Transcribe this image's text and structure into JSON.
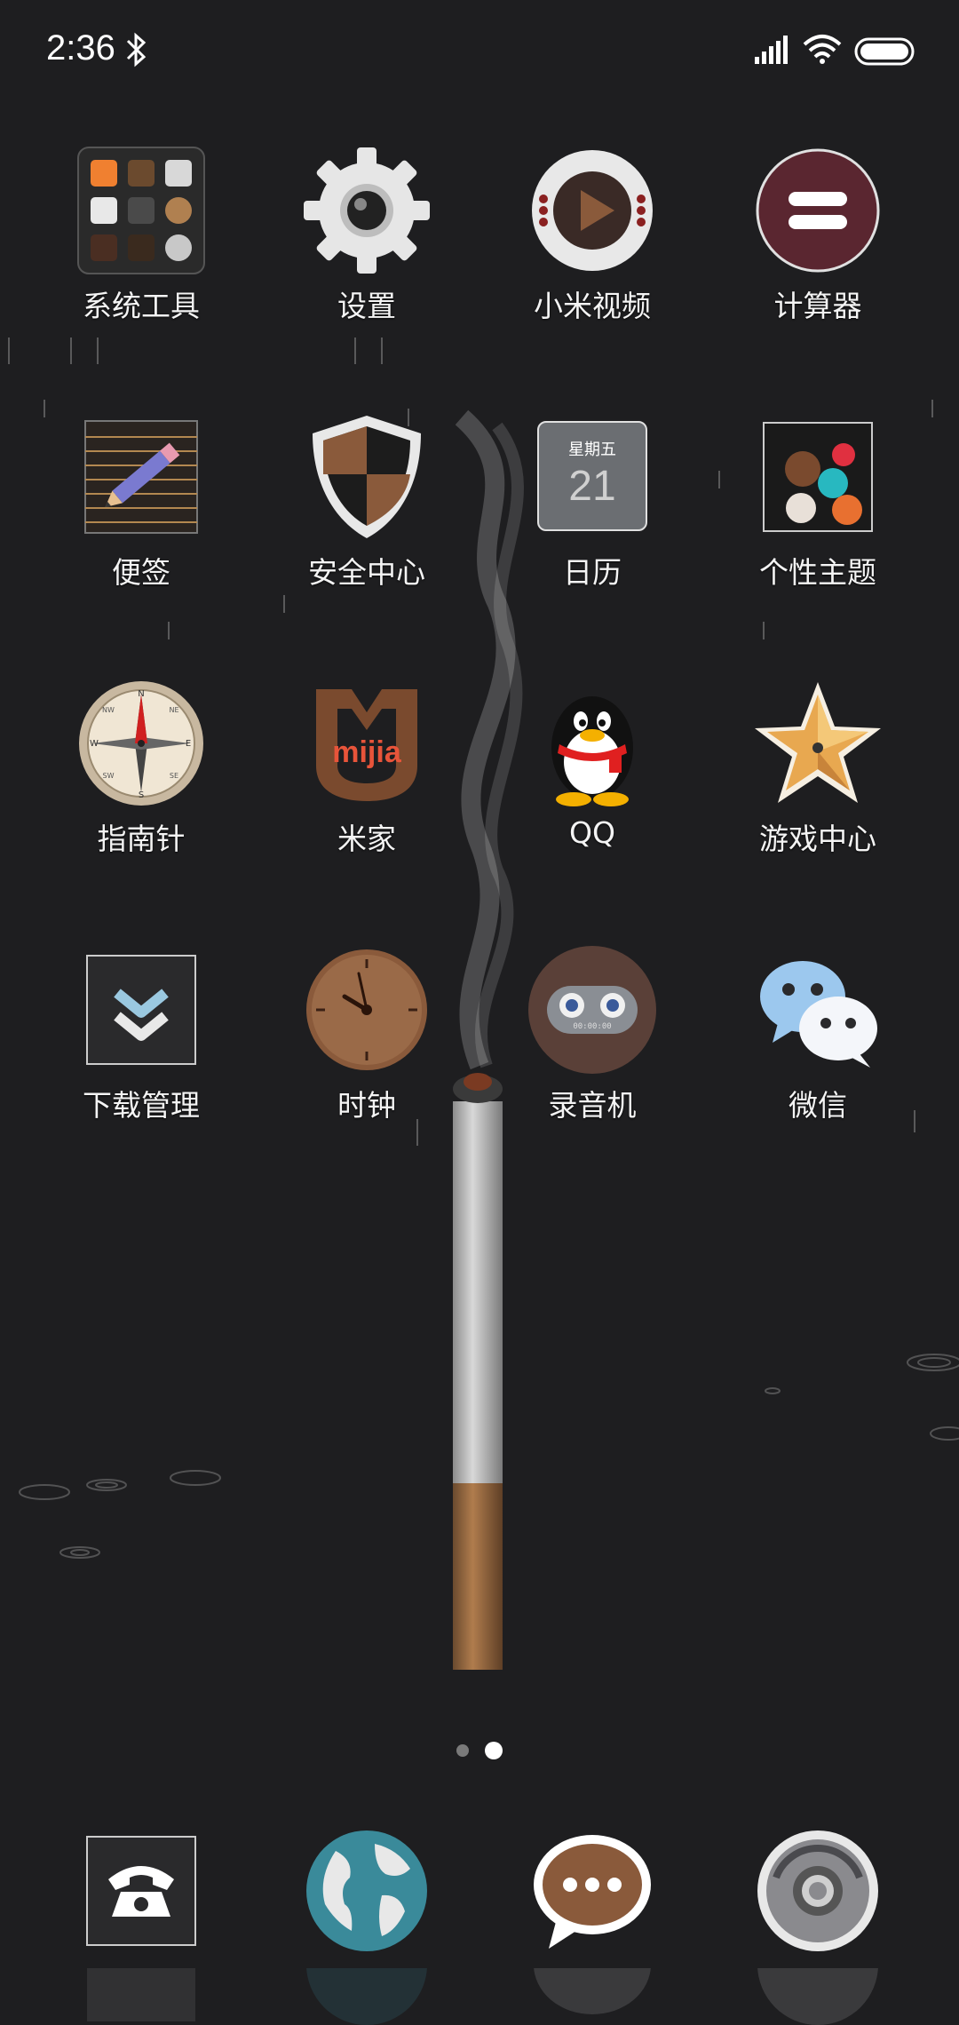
{
  "status_bar": {
    "time": "2:36",
    "icons": [
      "bluetooth-icon",
      "signal-icon",
      "wifi-icon",
      "battery-icon"
    ]
  },
  "apps": [
    {
      "label": "系统工具",
      "icon": "folder-icon"
    },
    {
      "label": "设置",
      "icon": "gear-icon"
    },
    {
      "label": "小米视频",
      "icon": "video-play-icon"
    },
    {
      "label": "计算器",
      "icon": "calculator-icon"
    },
    {
      "label": "便签",
      "icon": "notes-pencil-icon"
    },
    {
      "label": "安全中心",
      "icon": "shield-icon"
    },
    {
      "label": "日历",
      "icon": "calendar-icon",
      "weekday": "星期五",
      "day": "21"
    },
    {
      "label": "个性主题",
      "icon": "theme-palette-icon"
    },
    {
      "label": "指南针",
      "icon": "compass-icon",
      "directions": [
        "N",
        "E",
        "S",
        "W",
        "NE",
        "SE",
        "SW",
        "NW"
      ]
    },
    {
      "label": "米家",
      "icon": "mijia-icon",
      "wordmark": "mijia"
    },
    {
      "label": "QQ",
      "icon": "penguin-icon"
    },
    {
      "label": "游戏中心",
      "icon": "star-icon"
    },
    {
      "label": "下载管理",
      "icon": "download-chevron-icon"
    },
    {
      "label": "时钟",
      "icon": "clock-icon"
    },
    {
      "label": "录音机",
      "icon": "recorder-icon",
      "readout": "00:00:00"
    },
    {
      "label": "微信",
      "icon": "wechat-icon"
    }
  ],
  "page_indicator": {
    "pages": 2,
    "active_page": 2
  },
  "dock": [
    {
      "name": "phone",
      "icon": "phone-icon"
    },
    {
      "name": "browser",
      "icon": "globe-icon"
    },
    {
      "name": "messages",
      "icon": "chat-bubble-icon"
    },
    {
      "name": "camera",
      "icon": "camera-icon"
    }
  ],
  "colors": {
    "background": "#1e1e20",
    "label": "#f4f4f4",
    "accent_brown": "#8a5a3b"
  }
}
